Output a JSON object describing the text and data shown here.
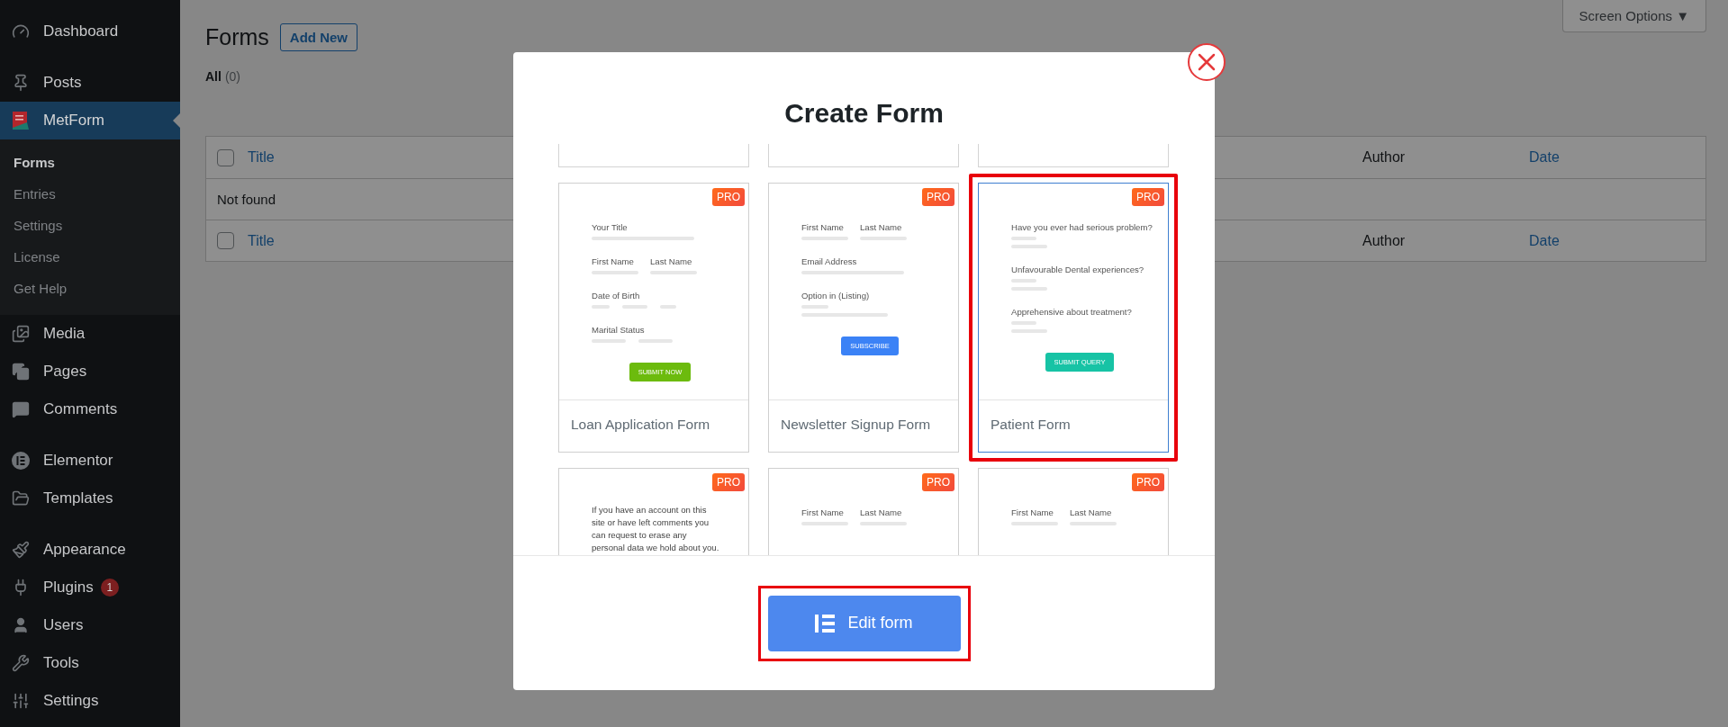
{
  "sidebar": {
    "groups": [
      [
        {
          "label": "Dashboard",
          "selected": false
        }
      ],
      [
        {
          "label": "Posts",
          "selected": false
        },
        {
          "label": "MetForm",
          "selected": true,
          "children": [
            {
              "label": "Forms",
              "selected": true
            },
            {
              "label": "Entries",
              "selected": false
            },
            {
              "label": "Settings",
              "selected": false
            },
            {
              "label": "License",
              "selected": false
            },
            {
              "label": "Get Help",
              "selected": false
            }
          ]
        },
        {
          "label": "Media",
          "selected": false
        },
        {
          "label": "Pages",
          "selected": false
        },
        {
          "label": "Comments",
          "selected": false
        }
      ],
      [
        {
          "label": "Elementor",
          "selected": false
        },
        {
          "label": "Templates",
          "selected": false
        }
      ],
      [
        {
          "label": "Appearance",
          "selected": false
        },
        {
          "label": "Plugins",
          "selected": false,
          "badge": "1"
        },
        {
          "label": "Users",
          "selected": false
        },
        {
          "label": "Tools",
          "selected": false
        },
        {
          "label": "Settings",
          "selected": false
        }
      ]
    ]
  },
  "page": {
    "title": "Forms",
    "add_button": "Add New",
    "screen_options": "Screen Options ▼",
    "filters": [
      {
        "label": "All",
        "count": "(0)"
      }
    ],
    "table": {
      "columns": [
        "Title",
        "Author",
        "Date"
      ],
      "header_checkbox": {
        "checked": false
      },
      "empty_text": "Not found",
      "footer_checkbox": {
        "checked": false
      },
      "footer_columns": [
        "Title",
        "Author",
        "Date"
      ]
    }
  },
  "modal": {
    "title": "Create Form",
    "templates": [
      {
        "title": "Loan Application Form",
        "badge": "PRO",
        "selected": false,
        "highlighted": false,
        "fields": [
          {
            "kind": "input",
            "labels": [
              "Your Title"
            ]
          },
          {
            "kind": "split",
            "labels": [
              "First Name",
              "Last Name"
            ]
          },
          {
            "kind": "date",
            "labels": [
              "Date of Birth"
            ]
          },
          {
            "kind": "options",
            "labels": [
              "Marital Status"
            ]
          }
        ],
        "button": {
          "label": "SUBMIT NOW",
          "color": "#6cbb0d"
        }
      },
      {
        "title": "Newsletter Signup Form",
        "badge": "PRO",
        "selected": false,
        "highlighted": false,
        "fields": [
          {
            "kind": "split",
            "labels": [
              "First Name",
              "Last Name"
            ]
          },
          {
            "kind": "input",
            "labels": [
              "Email Address"
            ]
          },
          {
            "kind": "list",
            "labels": [
              "Option in (Listing)"
            ]
          }
        ],
        "button": {
          "label": "SUBSCRIBE",
          "color": "#3b82f6"
        }
      },
      {
        "title": "Patient Form",
        "badge": "PRO",
        "selected": true,
        "highlighted": true,
        "fields": [
          {
            "kind": "radio",
            "labels": [
              "Have you ever had serious problem?"
            ]
          },
          {
            "kind": "radio",
            "labels": [
              "Unfavourable Dental experiences?"
            ]
          },
          {
            "kind": "radio",
            "labels": [
              "Apprehensive about treatment?"
            ]
          }
        ],
        "button": {
          "label": "SUBMIT QUERY",
          "color": "#17c3a5"
        }
      },
      {
        "badge": "PRO",
        "selected": false,
        "highlighted": false,
        "fields": [
          {
            "kind": "paragraph",
            "labels": [
              "If you have an account on this site or have left comments you can request to erase any personal data we hold about you."
            ]
          }
        ]
      },
      {
        "badge": "PRO",
        "selected": false,
        "highlighted": false,
        "fields": [
          {
            "kind": "split",
            "labels": [
              "First Name",
              "Last Name"
            ]
          }
        ]
      },
      {
        "badge": "PRO",
        "selected": false,
        "highlighted": false,
        "fields": [
          {
            "kind": "split",
            "labels": [
              "First Name",
              "Last Name"
            ]
          }
        ]
      }
    ],
    "edit_button": {
      "label": "Edit form",
      "highlighted": true
    }
  }
}
